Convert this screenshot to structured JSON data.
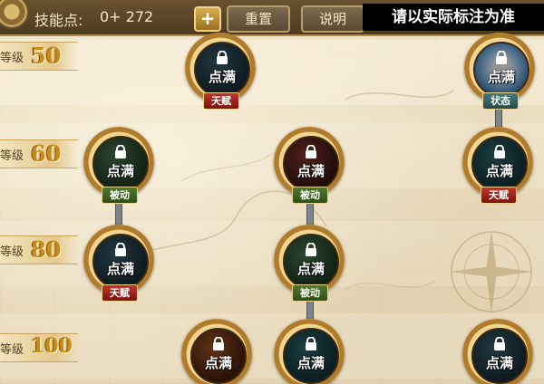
{
  "topbar": {
    "skill_points_label": "技能点:",
    "skill_points_value": "0+ 272",
    "plus_symbol": "+",
    "reset_label": "重置",
    "help_label": "说明",
    "note": "请以实际标注为准"
  },
  "levels": [
    {
      "prefix": "等级",
      "value": "50"
    },
    {
      "prefix": "等级",
      "value": "60"
    },
    {
      "prefix": "等级",
      "value": "80"
    },
    {
      "prefix": "等级",
      "value": "100"
    }
  ],
  "status_text": "点满",
  "tags": {
    "talent": "天赋",
    "passive": "被动",
    "state": "状态"
  },
  "nodes": [
    {
      "level": "50",
      "icon": "skill-talent-icon",
      "caption": "点满",
      "tag": "天赋"
    },
    {
      "level": "50",
      "icon": "skill-state-icon",
      "caption": "点满",
      "tag": "状态"
    },
    {
      "level": "60",
      "icon": "skill-passive-icon",
      "caption": "点满",
      "tag": "被动"
    },
    {
      "level": "60",
      "icon": "skill-passive-icon",
      "caption": "点满",
      "tag": "被动"
    },
    {
      "level": "60",
      "icon": "skill-talent-icon",
      "caption": "点满",
      "tag": "天赋"
    },
    {
      "level": "80",
      "icon": "skill-talent-icon",
      "caption": "点满",
      "tag": "天赋"
    },
    {
      "level": "80",
      "icon": "skill-passive-icon",
      "caption": "点满",
      "tag": "被动"
    },
    {
      "level": "100",
      "icon": "skill-icon",
      "caption": "点满",
      "tag": ""
    },
    {
      "level": "100",
      "icon": "skill-icon",
      "caption": "点满",
      "tag": ""
    },
    {
      "level": "100",
      "icon": "skill-icon",
      "caption": "点满",
      "tag": ""
    }
  ],
  "colors": {
    "talent_tag": "#c2342a",
    "passive_tag": "#4f7a2c",
    "state_tag": "#497a7a",
    "level_number": "#c98b17",
    "parchment": "#e9dcc0"
  }
}
